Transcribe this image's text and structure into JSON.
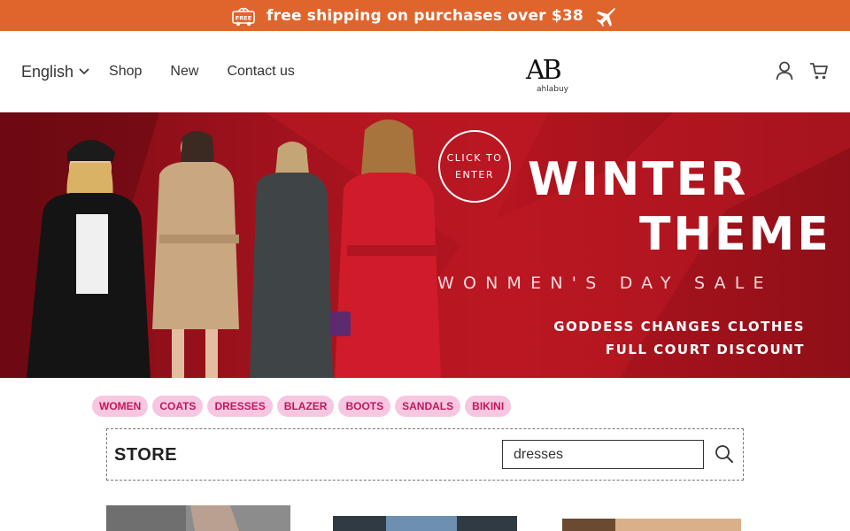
{
  "announcement": {
    "text": "free shipping on purchases over $38",
    "badge_text": "FREE"
  },
  "header": {
    "language": "English",
    "nav": [
      "Shop",
      "New",
      "Contact us"
    ],
    "logo_mark": "AB",
    "logo_text": "ahlabuy"
  },
  "hero": {
    "cta": [
      "CLICK TO",
      "ENTER"
    ],
    "title_line1": "WINTER",
    "title_line2": "THEME",
    "subtitle": "WONMEN'S DAY SALE",
    "line1": "GODDESS CHANGES CLOTHES",
    "line2": "FULL COURT DISCOUNT"
  },
  "tags": [
    "WOMEN",
    "COATS",
    "DRESSES",
    "BLAZER",
    "BOOTS",
    "SANDALS",
    "BIKINI"
  ],
  "store": {
    "title": "STORE",
    "search_value": "dresses"
  },
  "colors": {
    "announce_bg": "#e0652d",
    "hero_bg": "#a3131e",
    "tag_bg": "#f7c6e1",
    "tag_text": "#c2185b"
  },
  "icons": {
    "announce_left": "gift-truck-icon",
    "announce_right": "airplane-icon",
    "lang_dropdown": "chevron-down-icon",
    "account": "user-icon",
    "cart": "cart-icon",
    "search": "search-icon"
  }
}
